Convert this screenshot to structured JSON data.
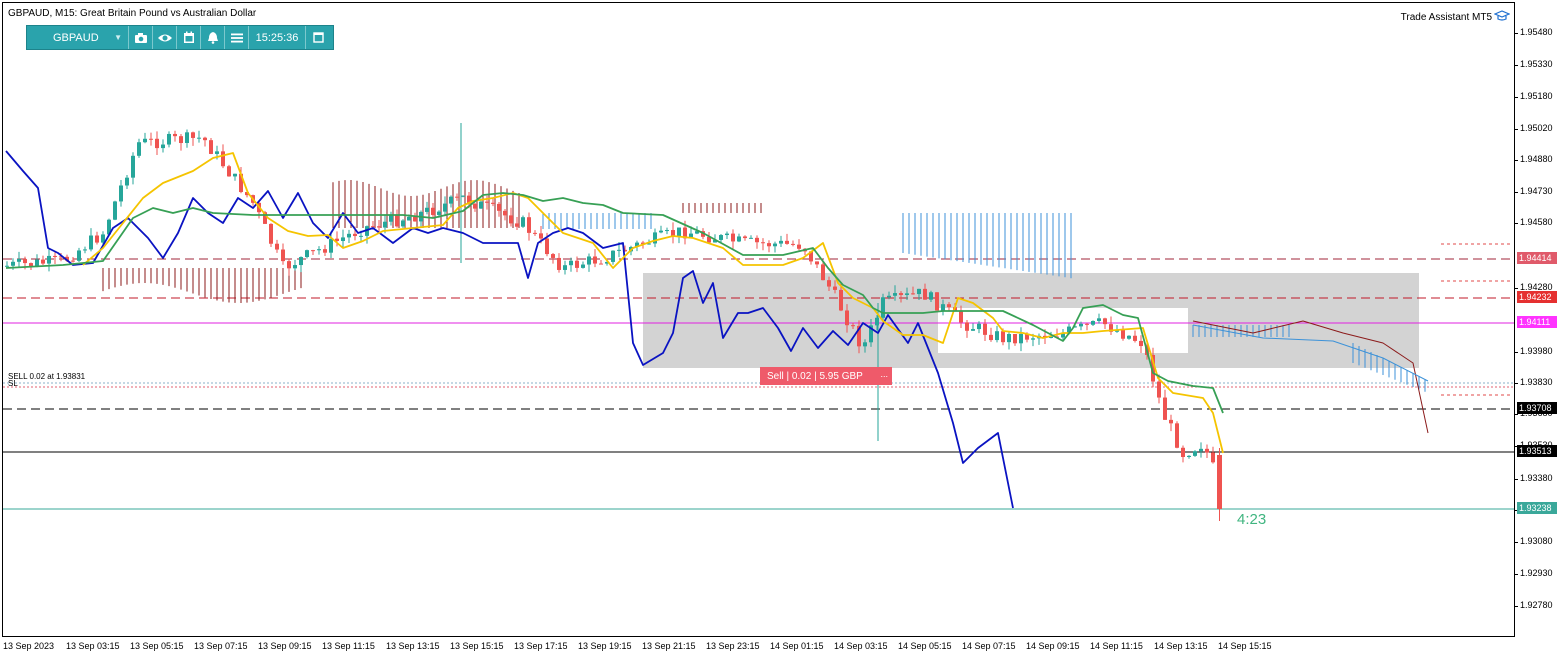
{
  "window": {
    "title": "GBPAUD, M15:  Great Britain Pound vs Australian Dollar",
    "trade_assistant": "Trade Assistant MT5"
  },
  "toolbar": {
    "symbol": "GBPAUD",
    "time": "15:25:36",
    "buttons": [
      "camera-icon",
      "eye-icon",
      "calendar-icon",
      "bell-icon",
      "menu-icon",
      "window-icon"
    ]
  },
  "trade": {
    "sell_annotation": "SELL 0.02 at 1.93831",
    "sl_annotation": "SL",
    "badge": "Sell | 0.02 | 5.95 GBP",
    "badge_close": "..."
  },
  "countdown": "4:23",
  "y_axis": {
    "ticks": [
      "1.95480",
      "1.95330",
      "1.95180",
      "1.95020",
      "1.94880",
      "1.94730",
      "1.94580",
      "1.94280",
      "1.93980",
      "1.93830",
      "1.93680",
      "1.93530",
      "1.93380",
      "1.93230",
      "1.93080",
      "1.92930",
      "1.92780"
    ]
  },
  "price_labels": [
    {
      "text": "1.94414",
      "color": "#e05a6a",
      "price": 1.94414
    },
    {
      "text": "1.94232",
      "color": "#e53030",
      "price": 1.94232
    },
    {
      "text": "1.94111",
      "color": "#ff33ff",
      "price": 1.94111
    },
    {
      "text": "1.93708",
      "color": "#000000",
      "price": 1.93708
    },
    {
      "text": "1.93513",
      "color": "#000000",
      "price": 1.93513
    },
    {
      "text": "1.93238",
      "color": "#3aa89a",
      "price": 1.93238
    }
  ],
  "x_axis": {
    "ticks": [
      "13 Sep 2023",
      "13 Sep 03:15",
      "13 Sep 05:15",
      "13 Sep 07:15",
      "13 Sep 09:15",
      "13 Sep 11:15",
      "13 Sep 13:15",
      "13 Sep 15:15",
      "13 Sep 17:15",
      "13 Sep 19:15",
      "13 Sep 21:15",
      "13 Sep 23:15",
      "14 Sep 01:15",
      "14 Sep 03:15",
      "14 Sep 05:15",
      "14 Sep 07:15",
      "14 Sep 09:15",
      "14 Sep 11:15",
      "14 Sep 13:15",
      "14 Sep 15:15"
    ]
  },
  "colors": {
    "bull": "#26a69a",
    "bear": "#ef5350",
    "blue_line": "#0a13c2",
    "yellow_line": "#f5c400",
    "green_line": "#37a055",
    "cloud_up": "#3d92d8",
    "cloud_down": "#8b1a1a",
    "box": "#c0c0c0"
  }
}
